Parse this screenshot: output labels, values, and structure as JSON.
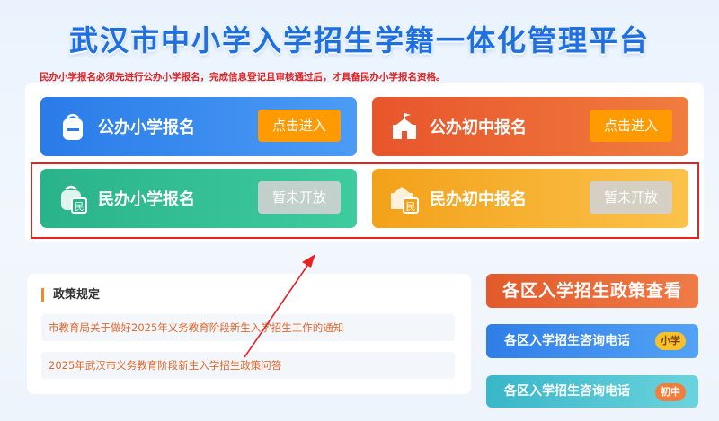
{
  "header": {
    "title": "武汉市中小学入学招生学籍一体化管理平台",
    "notice": "民办小学报名必须先进行公办小学报名，完成信息登记且审核通过后，才具备民办小学报名资格。"
  },
  "cards": [
    {
      "label": "公办小学报名",
      "button": "点击进入",
      "icon": "backpack-icon"
    },
    {
      "label": "公办初中报名",
      "button": "点击进入",
      "icon": "school-building-icon"
    },
    {
      "label": "民办小学报名",
      "button": "暂未开放",
      "icon": "backpack-private-icon"
    },
    {
      "label": "民办初中报名",
      "button": "暂未开放",
      "icon": "school-private-icon"
    }
  ],
  "policy": {
    "title": "政策规定",
    "items": [
      "市教育局关于做好2025年义务教育阶段新生入学招生工作的通知",
      "2025年武汉市义务教育阶段新生入学招生政策问答"
    ]
  },
  "side": {
    "policy_lookup": "各区入学招生政策查看",
    "phone_primary": "各区入学招生咨询电话",
    "phone_primary_tag": "小学",
    "phone_middle": "各区入学招生咨询电话",
    "phone_middle_tag": "初中"
  },
  "colors": {
    "title": "#1e6fe0",
    "notice": "#e02424",
    "enter_button": "#ff9a00",
    "highlight_box": "#e52323"
  }
}
